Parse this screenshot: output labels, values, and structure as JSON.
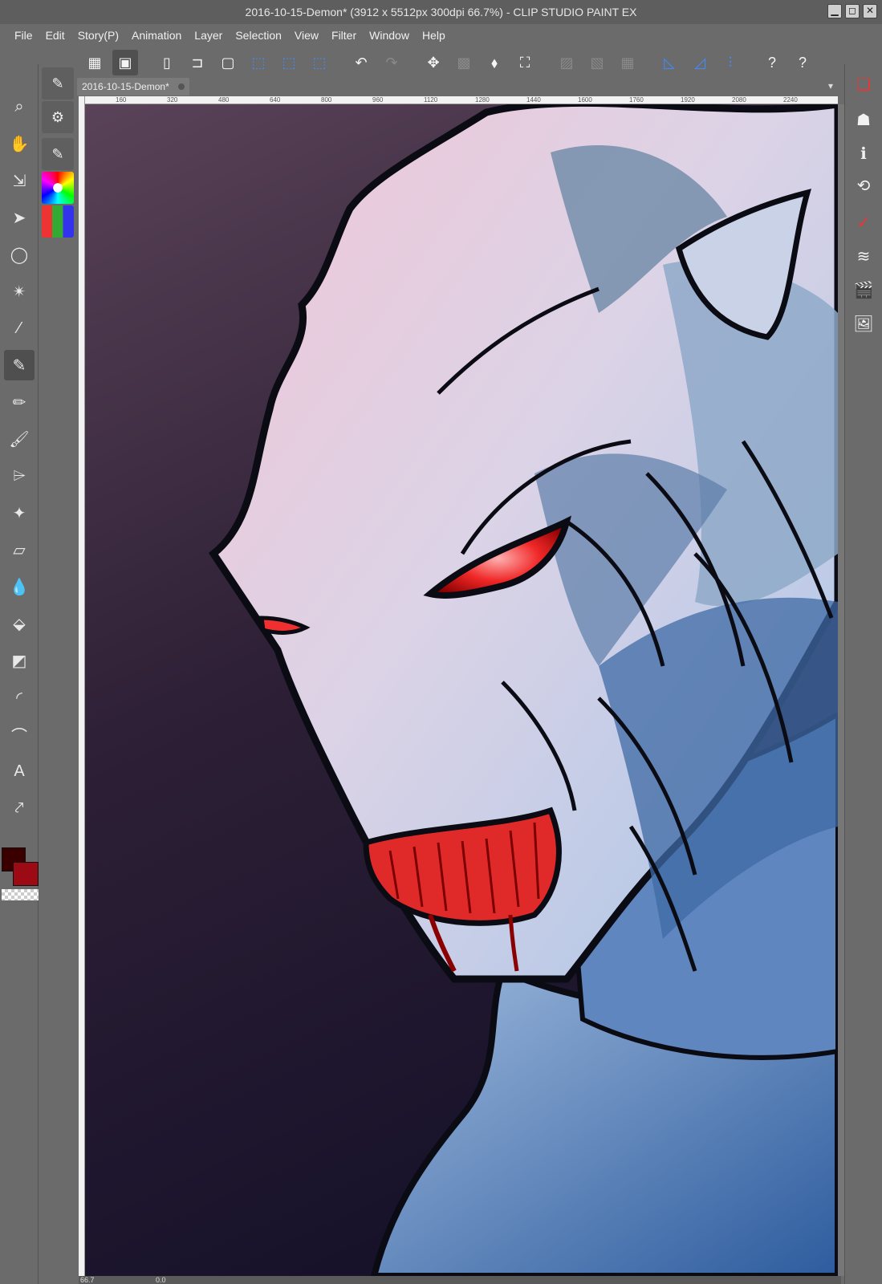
{
  "window": {
    "title": "2016-10-15-Demon* (3912 x 5512px 300dpi 66.7%)  - CLIP STUDIO PAINT EX",
    "controls": {
      "minimize": "▁",
      "maximize": "◻",
      "close": "✕"
    }
  },
  "menu": {
    "items": [
      "File",
      "Edit",
      "Story(P)",
      "Animation",
      "Layer",
      "Selection",
      "View",
      "Filter",
      "Window",
      "Help"
    ]
  },
  "command_bar": {
    "icons": [
      "grid-icon",
      "navigator-icon",
      "new-file-icon",
      "open-file-icon",
      "save-icon",
      "select-arrow-icon",
      "select-arrow-icon",
      "select-arrow-icon",
      "undo-icon",
      "redo-icon",
      "transform-icon",
      "fill-icon",
      "bucket-icon",
      "free-transform-icon",
      "disabled-1-icon",
      "disabled-2-icon",
      "disabled-3-icon",
      "ruler-icon",
      "ruler-2-icon",
      "snap-icon",
      "help-icon",
      "help-2-icon"
    ]
  },
  "tab": {
    "label": "2016-10-15-Demon*",
    "menu": "▾"
  },
  "ruler": {
    "ticks": [
      "160",
      "320",
      "480",
      "640",
      "800",
      "960",
      "1120",
      "1280",
      "1440",
      "1600",
      "1760",
      "1920",
      "2080",
      "2240"
    ]
  },
  "tools": {
    "items": [
      "zoom-icon",
      "hand-icon",
      "move-icon",
      "object-icon",
      "lasso-icon",
      "magic-wand-icon",
      "eyedropper-icon",
      "pen-icon",
      "pencil-icon",
      "brush-icon",
      "airbrush-icon",
      "decoration-icon",
      "eraser-icon",
      "blend-icon",
      "fill-icon",
      "gradient-icon",
      "figure-icon",
      "curve-icon",
      "text-icon",
      "balloon-icon"
    ],
    "active": "pen-icon"
  },
  "colors": {
    "main": "#3a0000",
    "sub": "#9c0b14"
  },
  "status": {
    "zoom": "66.7",
    "angle": "0.0"
  }
}
